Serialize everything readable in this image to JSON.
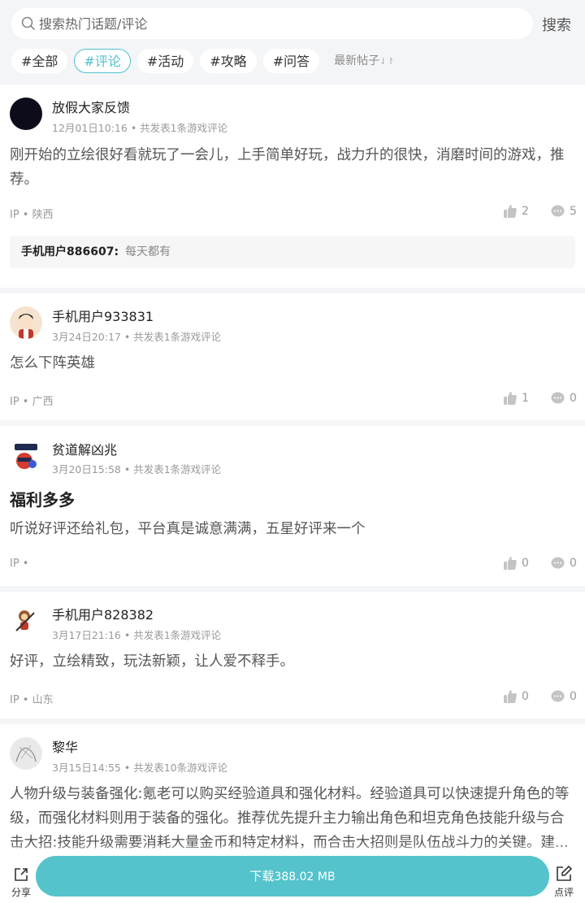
{
  "header": {
    "search_placeholder": "搜索热门话题/评论",
    "search_button": "搜索",
    "tags": [
      "#全部",
      "#评论",
      "#活动",
      "#攻略",
      "#问答"
    ],
    "active_tag_index": 1,
    "sort_label": "最新帖子",
    "sort_icon": "⇃↾"
  },
  "posts": [
    {
      "username": "放假大家反馈",
      "time": "12月01日10:16",
      "summary": "共发表1条游戏评论",
      "text": "刚开始的立绘很好看就玩了一会儿，上手简单好玩，战力升的很快，消磨时间的游戏，推荐。",
      "ip": "IP • 陕西",
      "likes": "2",
      "comments": "5",
      "reply": {
        "user": "手机用户886607:",
        "text": "每天都有"
      }
    },
    {
      "username": "手机用户933831",
      "time": "3月24日20:17",
      "summary": "共发表1条游戏评论",
      "text": "怎么下阵英雄",
      "ip": "IP • 广西",
      "likes": "1",
      "comments": "0"
    },
    {
      "username": "贫道解凶兆",
      "time": "3月20日15:58",
      "summary": "共发表1条游戏评论",
      "title": "福利多多",
      "text": "听说好评还给礼包，平台真是诚意满满，五星好评来一个",
      "ip": "IP •",
      "likes": "0",
      "comments": "0"
    },
    {
      "username": "手机用户828382",
      "time": "3月17日21:16",
      "summary": "共发表1条游戏评论",
      "text": "好评，立绘精致，玩法新颖，让人爱不释手。",
      "ip": "IP • 山东",
      "likes": "0",
      "comments": "0"
    },
    {
      "username": "黎华",
      "time": "3月15日14:55",
      "summary": "共发表10条游戏评论",
      "text": "人物升级与装备强化:氪老可以购买经验道具和强化材料。经验道具可以快速提升角色的等级，而强化材料则用于装备的强化。推荐优先提升主力输出角色和坦克角色技能升级与合击大招:技能升级需要消耗大量金币和特定材料，而合击大招则是队伍战斗力的关键。建..."
    }
  ],
  "bottom": {
    "share_label": "分享",
    "download_label": "下载",
    "download_size": "388.02 MB",
    "review_label": "点评"
  },
  "colors": {
    "accent": "#54c3cc",
    "background": "#f4f5f7"
  }
}
